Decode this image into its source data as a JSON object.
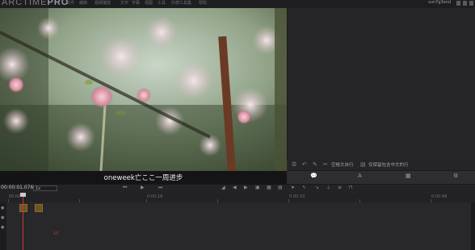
{
  "app": {
    "logo_main": "ARCTIME",
    "logo_pro": "PRO",
    "menu_items": [
      "文件",
      "编辑",
      "视频播放",
      "文字",
      "字幕",
      "视图",
      "工具",
      "外部工具集",
      "帮助"
    ],
    "user_name": "sun7g3end"
  },
  "video": {
    "subtitle_text": "oneweek亡ここ一周进步"
  },
  "right_panel": {
    "toolbar_labels": [
      "空格文自行",
      "仅保留包含中文的行"
    ],
    "icons": [
      "list-icon",
      "undo-icon",
      "pencil-icon",
      "scissors-icon"
    ],
    "tabs": [
      "chat-bubble-icon",
      "text-format-icon",
      "grid-icon",
      "gear-icon"
    ]
  },
  "timeline": {
    "timecode": "00:00:01.076",
    "zoom": "1x",
    "ruler_labels": [
      "00:00",
      "0:00:18",
      "0:00:33",
      "0:00:48"
    ],
    "marker_text": "10"
  },
  "colors": {
    "background": "#2b2b2d",
    "playhead": "#c23b3b",
    "clip": "#6e5426"
  }
}
